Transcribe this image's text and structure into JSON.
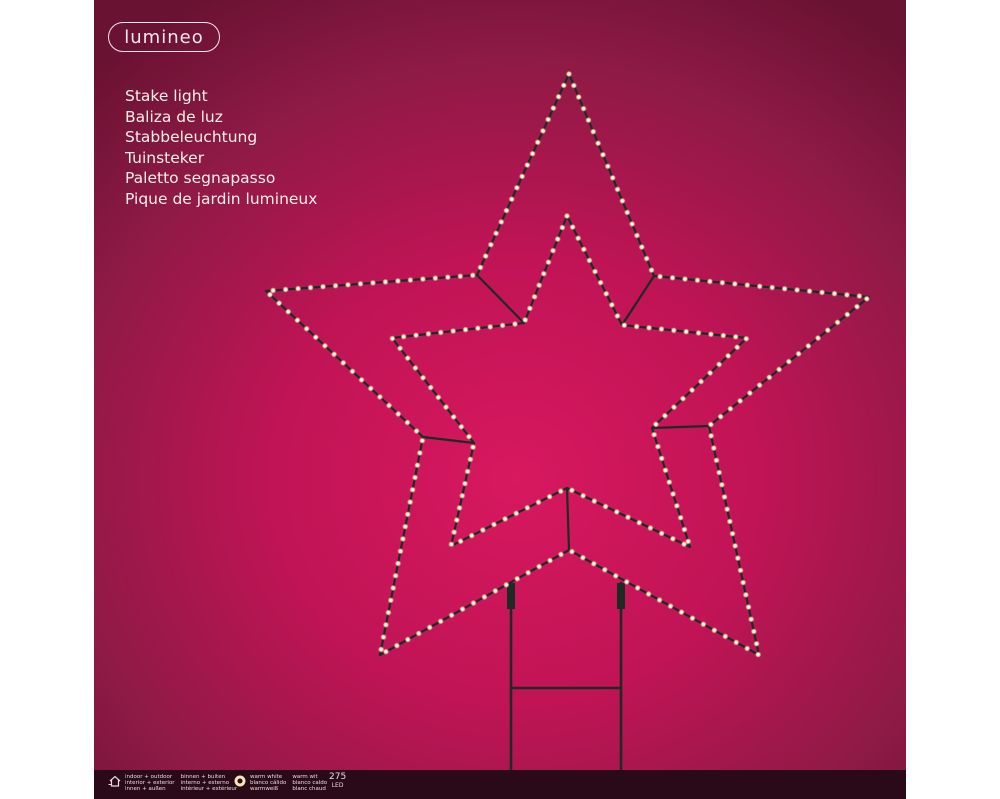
{
  "brand": {
    "logo_text": "lumineo"
  },
  "product_names": [
    "Stake light",
    "Baliza de luz",
    "Stabbeleuchtung",
    "Tuinsteker",
    "Paletto segnapasso",
    "Pique de jardin lumineux"
  ],
  "footer": {
    "usage": {
      "icon": "house-icon",
      "col1": [
        "indoor + outdoor",
        "interior + exterior",
        "innen + außen"
      ],
      "col2": [
        "binnen + buiten",
        "interno + esterno",
        "intérieur + extérieur"
      ]
    },
    "light_color": {
      "icon": "bulb-icon",
      "col1": [
        "warm white",
        "blanco cálido",
        "warmweiß"
      ],
      "col2": [
        "warm wit",
        "bianco caldo",
        "blanc chaud"
      ]
    },
    "led": {
      "count": "275",
      "unit": "LED"
    }
  },
  "colors": {
    "background_center": "#d8185f",
    "background_edge": "#6a1232",
    "frame": "#1e2a24",
    "led_glow": "#fff6d6",
    "footer_bg": "#2a0a18"
  },
  "led_count": 275
}
